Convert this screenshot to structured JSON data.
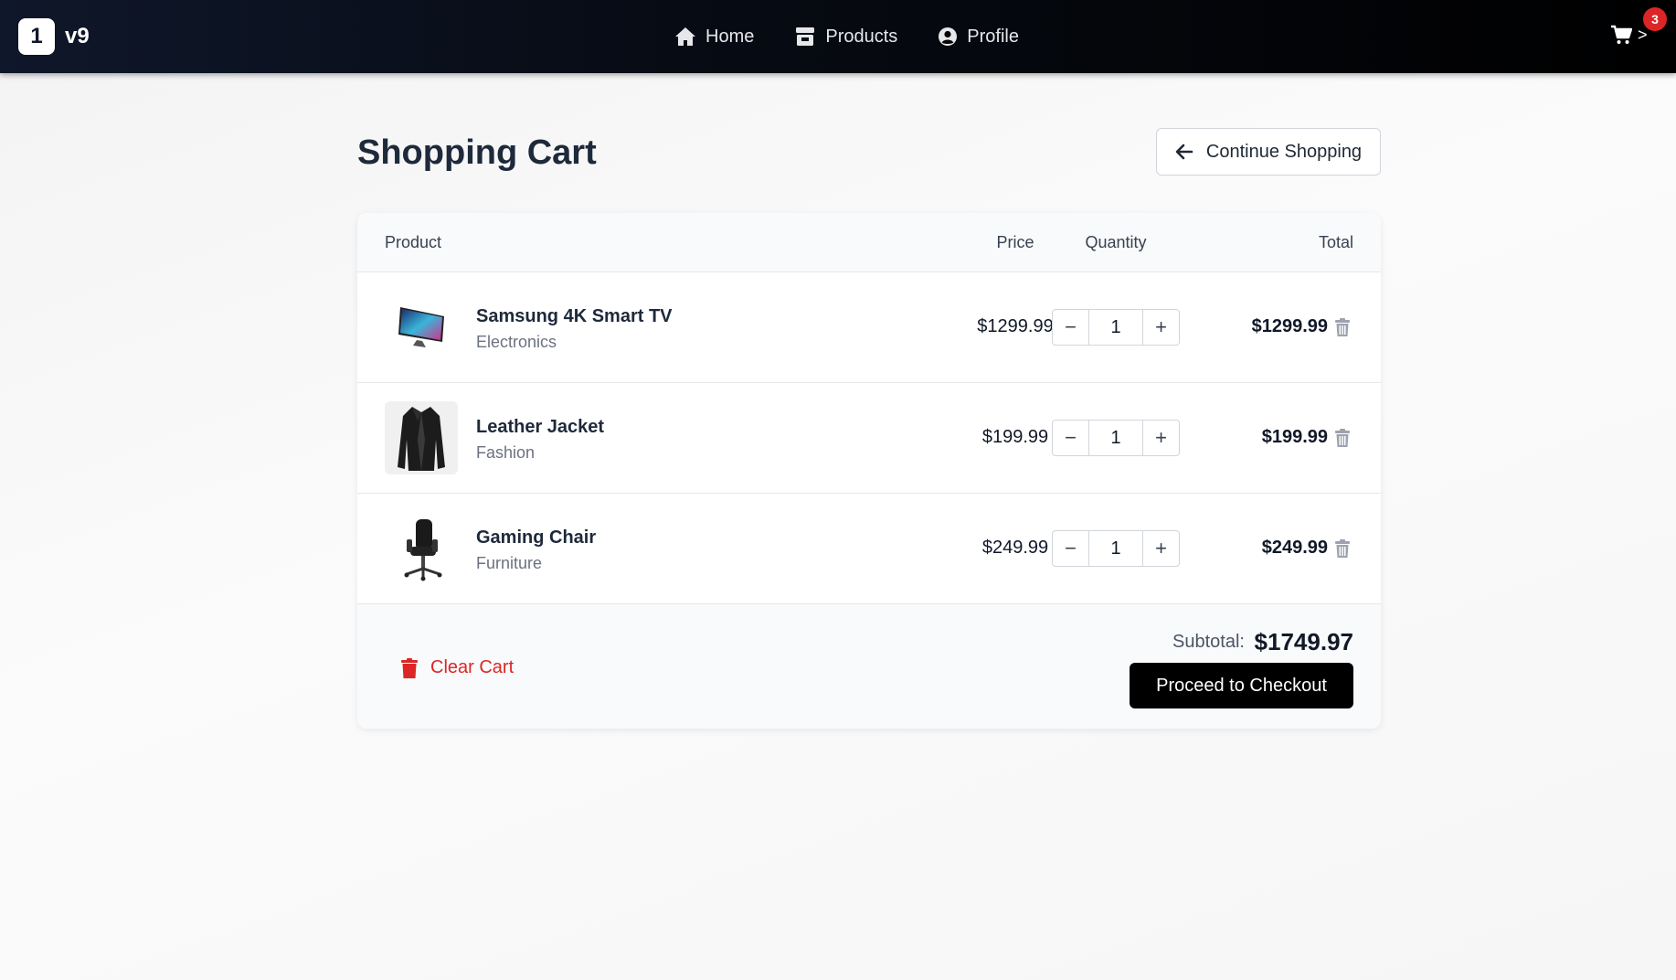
{
  "nav": {
    "logo_char": "1",
    "brand": "v9",
    "links": [
      {
        "label": "Home",
        "icon": "home-icon"
      },
      {
        "label": "Products",
        "icon": "store-icon"
      },
      {
        "label": "Profile",
        "icon": "user-circle-icon"
      }
    ],
    "cart_count": "3",
    "cart_chevron": ">"
  },
  "page": {
    "title": "Shopping Cart",
    "continue_label": "Continue Shopping"
  },
  "table": {
    "headers": {
      "product": "Product",
      "price": "Price",
      "quantity": "Quantity",
      "total": "Total"
    },
    "items": [
      {
        "name": "Samsung 4K Smart TV",
        "category": "Electronics",
        "price": "$1299.99",
        "qty": "1",
        "total": "$1299.99",
        "image": "tv-image"
      },
      {
        "name": "Leather Jacket",
        "category": "Fashion",
        "price": "$199.99",
        "qty": "1",
        "total": "$199.99",
        "image": "jacket-image"
      },
      {
        "name": "Gaming Chair",
        "category": "Furniture",
        "price": "$249.99",
        "qty": "1",
        "total": "$249.99",
        "image": "chair-image"
      }
    ],
    "qty_minus": "−",
    "qty_plus": "+"
  },
  "footer": {
    "clear_label": "Clear Cart",
    "subtotal_label": "Subtotal:",
    "subtotal_value": "$1749.97",
    "checkout_label": "Proceed to Checkout"
  },
  "colors": {
    "accent": "#000000",
    "danger": "#dc2626",
    "nav_bg": "#0f172a"
  }
}
